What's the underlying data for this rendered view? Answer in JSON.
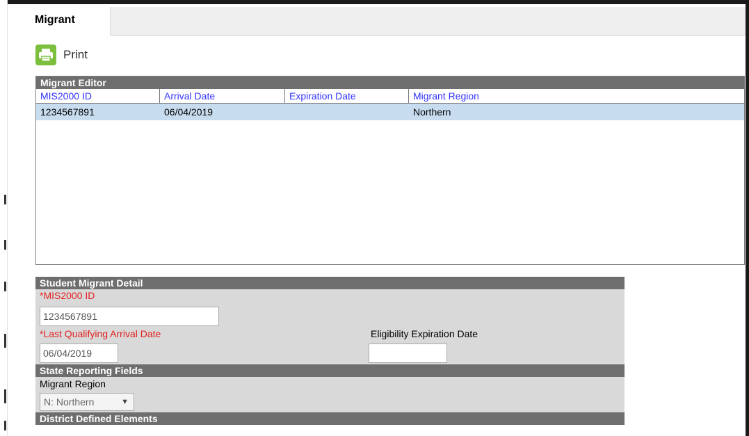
{
  "tab": {
    "label": "Migrant"
  },
  "toolbar": {
    "print_label": "Print"
  },
  "editor": {
    "title": "Migrant Editor",
    "columns": [
      "MIS2000 ID",
      "Arrival Date",
      "Expiration Date",
      "Migrant Region"
    ],
    "rows": [
      {
        "mis_id": "1234567891",
        "arrival": "06/04/2019",
        "expiration": "",
        "region": "Northern"
      }
    ]
  },
  "detail": {
    "title": "Student Migrant Detail",
    "mis_label": "*MIS2000 ID",
    "mis_value": "1234567891",
    "arrival_label": "*Last Qualifying Arrival Date",
    "arrival_value": "06/04/2019",
    "expiration_label": "Eligibility Expiration Date",
    "expiration_value": "",
    "state_title": "State Reporting Fields",
    "region_label": "Migrant Region",
    "region_value": "N: Northern",
    "district_title": "District Defined Elements"
  },
  "colors": {
    "accent_green": "#7cbf3f",
    "header_gray": "#6e6e6e",
    "selected_row": "#c8dcef",
    "required_red": "#e31f1f",
    "link_blue": "#3333ff"
  }
}
